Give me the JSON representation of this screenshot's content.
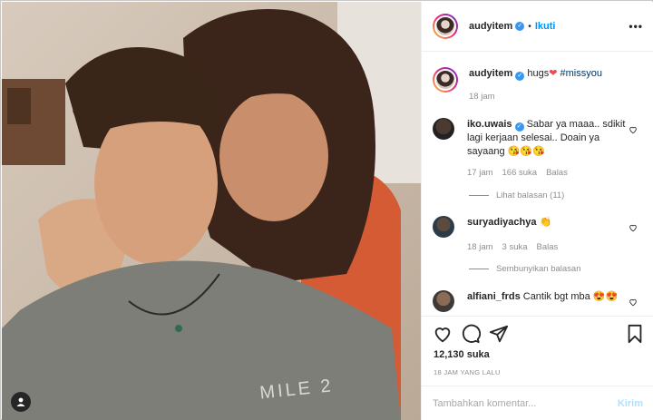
{
  "post": {
    "header": {
      "username": "audyitem",
      "separator": "•",
      "follow_label": "Ikuti",
      "more_label": "•••"
    },
    "caption": {
      "username": "audyitem",
      "text": "hugs",
      "emoji": "❤",
      "hashtag": "#missyou",
      "time": "18 jam"
    },
    "comments": [
      {
        "username": "iko.uwais",
        "verified": true,
        "text": "Sabar ya maaa.. sdikit lagi kerjaan selesai.. Doain ya sayaang 😘😘😘",
        "time": "17 jam",
        "likes": "166 suka",
        "reply": "Balas",
        "thread_label": "Lihat balasan (11)"
      },
      {
        "username": "suryadiyachya",
        "text": "👏",
        "time": "18 jam",
        "likes": "3 suka",
        "reply": "Balas",
        "thread_label": "Sembunyikan balasan"
      },
      {
        "username": "alfiani_frds",
        "text": "Cantik bgt mba 😍😍"
      }
    ],
    "likes_count": "12,130 suka",
    "timestamp": "18 JAM YANG LALU",
    "comment_input_placeholder": "Tambahkan komentar...",
    "post_button_label": "Kirim",
    "photo_text": "MILE 2"
  },
  "icons": {
    "like": "heart-icon",
    "comment": "comment-icon",
    "share": "share-icon",
    "save": "bookmark-icon",
    "tag": "user-tag-icon",
    "more": "more-options-icon"
  },
  "colors": {
    "accent": "#0095f6",
    "verified": "#3897f0",
    "muted": "#8e8e8e",
    "heart": "#ed4956"
  }
}
